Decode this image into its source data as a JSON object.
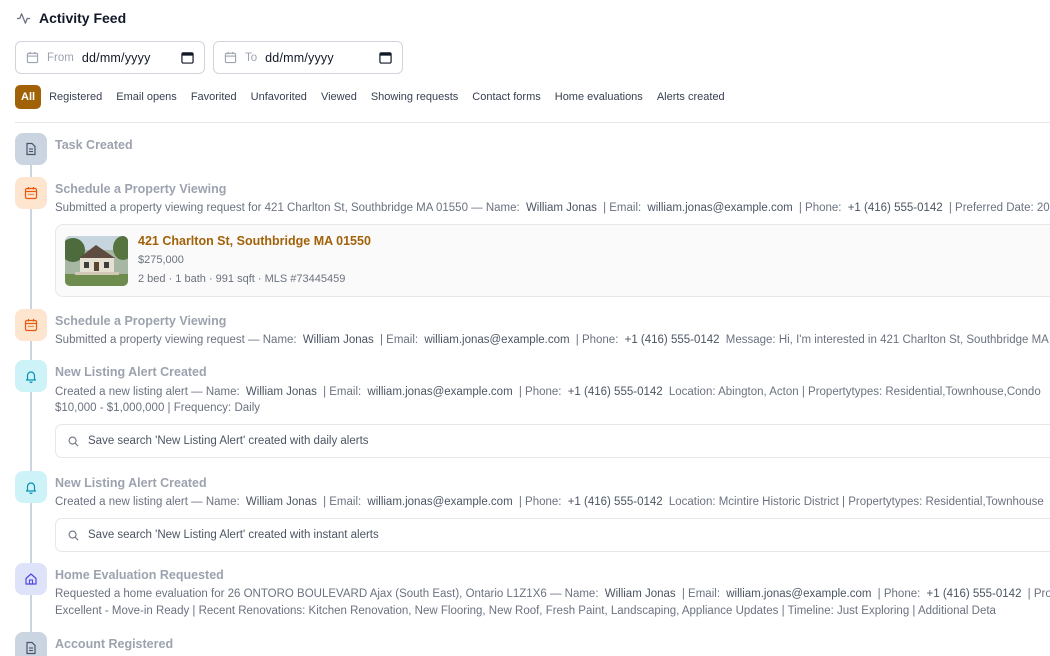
{
  "header": {
    "title": "Activity Feed",
    "icon": "activity-icon"
  },
  "date_filters": {
    "from": {
      "label": "From",
      "value": "dd/mm/yyyy"
    },
    "to": {
      "label": "To",
      "value": "dd/mm/yyyy"
    }
  },
  "filters": [
    "All",
    "Registered",
    "Email opens",
    "Favorited",
    "Unfavorited",
    "Viewed",
    "Showing requests",
    "Contact forms",
    "Home evaluations",
    "Alerts created"
  ],
  "active_filter": "All",
  "colors": {
    "accent": "#a16207"
  },
  "events": [
    {
      "title": "Task Created",
      "icon": "document-icon"
    },
    {
      "title": "Schedule a Property Viewing",
      "icon": "calendar-icon",
      "desc": {
        "prefix": "Submitted a property viewing request for 421 Charlton St, Southbridge MA 01550 — Name:",
        "name": "William Jonas",
        "email_label": "| Email:",
        "email": "william.jonas@example.com",
        "phone_label": "| Phone:",
        "phone": "+1 (416) 555-0142",
        "suffix": "| Preferred Date: 20"
      },
      "property": {
        "address": "421 Charlton St, Southbridge MA 01550",
        "price": "$275,000",
        "specs": "2 bed · 1 bath · 991 sqft · MLS #73445459"
      }
    },
    {
      "title": "Schedule a Property Viewing",
      "icon": "calendar-icon",
      "desc": {
        "prefix": "Submitted a property viewing request — Name:",
        "name": "William Jonas",
        "email_label": "| Email:",
        "email": "william.jonas@example.com",
        "phone_label": "| Phone:",
        "phone": "+1 (416) 555-0142",
        "suffix": "Message: Hi, I'm interested in 421 Charlton St, Southbridge MA"
      }
    },
    {
      "title": "New Listing Alert Created",
      "icon": "bell-icon",
      "desc": {
        "prefix": "Created a new listing alert — Name:",
        "name": "William Jonas",
        "email_label": "| Email:",
        "email": "william.jonas@example.com",
        "phone_label": "| Phone:",
        "phone": "+1 (416) 555-0142",
        "suffix": "Location: Abington, Acton | Propertytypes: Residential,Townhouse,Condo",
        "line2": "$10,000 - $1,000,000 | Frequency: Daily"
      },
      "search": "Save search 'New Listing Alert' created with daily alerts"
    },
    {
      "title": "New Listing Alert Created",
      "icon": "bell-icon",
      "desc": {
        "prefix": "Created a new listing alert — Name:",
        "name": "William Jonas",
        "email_label": "| Email:",
        "email": "william.jonas@example.com",
        "phone_label": "| Phone:",
        "phone": "+1 (416) 555-0142",
        "suffix": "Location: Mcintire Historic District | Propertytypes: Residential,Townhouse"
      },
      "search": "Save search 'New Listing Alert' created with instant alerts"
    },
    {
      "title": "Home Evaluation Requested",
      "icon": "home-icon",
      "desc": {
        "prefix": "Requested a home evaluation for 26 ONTORO BOULEVARD Ajax (South East), Ontario L1Z1X6 — Name:",
        "name": "William Jonas",
        "email_label": "| Email:",
        "email": "william.jonas@example.com",
        "phone_label": "| Phone:",
        "phone": "+1 (416) 555-0142",
        "suffix": "| Prope",
        "line2": "Excellent - Move-in Ready | Recent Renovations: Kitchen Renovation, New Flooring, New Roof, Fresh Paint, Landscaping, Appliance Updates | Timeline: Just Exploring | Additional Deta"
      }
    },
    {
      "title": "Account Registered",
      "icon": "document-icon"
    }
  ]
}
